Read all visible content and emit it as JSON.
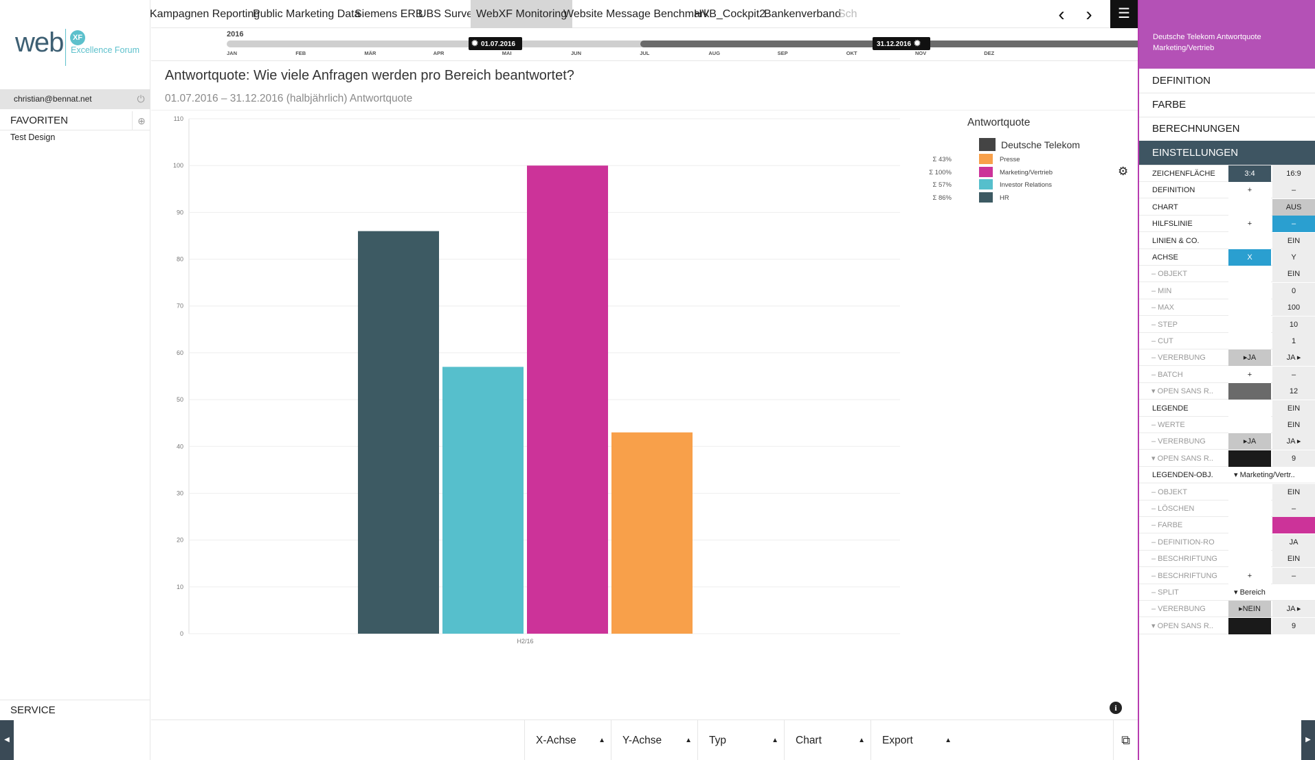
{
  "sidebar": {
    "logo_text": "web",
    "logo_badge": "XF",
    "logo_subtitle": "Excellence Forum",
    "user_email": "christian@bennat.net",
    "favorites_label": "FAVORITEN",
    "favorite_items": [
      "Test Design"
    ],
    "service_label": "SERVICE"
  },
  "tabs": [
    {
      "label": "Kampagnen Reporting",
      "active": false
    },
    {
      "label": "Public Marketing Data",
      "active": false
    },
    {
      "label": "Siemens ERB",
      "active": false
    },
    {
      "label": "UBS Survey",
      "active": false
    },
    {
      "label": "WebXF Monitoring",
      "active": true
    },
    {
      "label": "Website Message Benchmark",
      "active": false
    },
    {
      "label": "HVB_Cockpit2",
      "active": false
    },
    {
      "label": "Bankenverband",
      "active": false
    },
    {
      "label": "Sch",
      "active": false
    }
  ],
  "timeline": {
    "year": "2016",
    "start": "01.07.2016",
    "end": "31.12.2016",
    "months": [
      "JAN",
      "FEB",
      "MÄR",
      "APR",
      "MAI",
      "JUN",
      "JUL",
      "AUG",
      "SEP",
      "OKT",
      "NOV",
      "DEZ"
    ]
  },
  "title": "Antwortquote: Wie viele Anfragen werden pro Bereich beantwortet?",
  "subtitle": "01.07.2016 – 31.12.2016 (halbjährlich) Antwortquote",
  "chart_data": {
    "type": "bar",
    "categories": [
      "H2/16"
    ],
    "series": [
      {
        "name": "HR",
        "values": [
          86
        ],
        "color": "#3d5a63"
      },
      {
        "name": "Investor Relations",
        "values": [
          57
        ],
        "color": "#56bfcc"
      },
      {
        "name": "Marketing/Vertrieb",
        "values": [
          100
        ],
        "color": "#cc3399"
      },
      {
        "name": "Presse",
        "values": [
          43
        ],
        "color": "#f8a04a"
      }
    ],
    "ylim": [
      0,
      110
    ],
    "yticks": [
      0,
      10,
      20,
      30,
      40,
      50,
      60,
      70,
      80,
      90,
      100,
      110
    ],
    "grid": true,
    "legend": {
      "title": "Antwortquote",
      "placement": "top-right",
      "group": {
        "name": "Deutsche Telekom",
        "color": "#444444"
      },
      "entries": [
        {
          "pct": "Σ 43%",
          "name": "Presse",
          "color": "#f8a04a"
        },
        {
          "pct": "Σ 100%",
          "name": "Marketing/Vertrieb",
          "color": "#cc3399"
        },
        {
          "pct": "Σ 57%",
          "name": "Investor Relations",
          "color": "#56bfcc"
        },
        {
          "pct": "Σ 86%",
          "name": "HR",
          "color": "#3d5a63"
        }
      ]
    }
  },
  "bottom_toolbar": [
    "X-Achse",
    "Y-Achse",
    "Typ",
    "Chart",
    "Export"
  ],
  "panel": {
    "header_text": "Deutsche Telekom Antwortquote Marketing/Vertrieb",
    "header_color": "#b451b6",
    "sections": [
      "DEFINITION",
      "FARBE",
      "BERECHNUNGEN",
      "EINSTELLUNGEN"
    ],
    "settings": [
      {
        "label": "ZEICHENFLÄCHE",
        "c1": "3:4",
        "c2": "16:9",
        "c1cls": "c-dark",
        "c2cls": "",
        "sub": false
      },
      {
        "label": "DEFINITION",
        "c1": "+",
        "c2": "–",
        "c1cls": "",
        "c2cls": "",
        "sub": false
      },
      {
        "label": "CHART",
        "c1": "",
        "c2": "AUS",
        "c1cls": "",
        "c2cls": "c-grey",
        "sub": false
      },
      {
        "label": "HILFSLINIE",
        "c1": "+",
        "c2": "–",
        "c1cls": "",
        "c2cls": "c-blue",
        "sub": false
      },
      {
        "label": "LINIEN & CO.",
        "c1": "",
        "c2": "EIN",
        "c1cls": "",
        "c2cls": "",
        "sub": false
      },
      {
        "label": "ACHSE",
        "c1": "X",
        "c2": "Y",
        "c1cls": "c-blue",
        "c2cls": "",
        "sub": false
      },
      {
        "label": "– OBJEKT",
        "c1": "",
        "c2": "EIN",
        "c1cls": "",
        "c2cls": "",
        "sub": true
      },
      {
        "label": "– MIN",
        "c1": "",
        "c2": "0",
        "c1cls": "",
        "c2cls": "",
        "sub": true
      },
      {
        "label": "– MAX",
        "c1": "",
        "c2": "100",
        "c1cls": "",
        "c2cls": "",
        "sub": true
      },
      {
        "label": "– STEP",
        "c1": "",
        "c2": "10",
        "c1cls": "",
        "c2cls": "",
        "sub": true
      },
      {
        "label": "– CUT",
        "c1": "",
        "c2": "1",
        "c1cls": "",
        "c2cls": "",
        "sub": true
      },
      {
        "label": "– VERERBUNG",
        "c1": "▸JA",
        "c2": "JA ▸",
        "c1cls": "c-grey",
        "c2cls": "",
        "sub": true
      },
      {
        "label": "– BATCH",
        "c1": "+",
        "c2": "–",
        "c1cls": "",
        "c2cls": "",
        "sub": true
      },
      {
        "label": "▾ OPEN SANS R..",
        "c1": "",
        "c2": "12",
        "c1cls": "c-greyd",
        "c2cls": "",
        "sub": true
      },
      {
        "label": "LEGENDE",
        "c1": "",
        "c2": "EIN",
        "c1cls": "",
        "c2cls": "",
        "sub": false
      },
      {
        "label": "– WERTE",
        "c1": "",
        "c2": "EIN",
        "c1cls": "",
        "c2cls": "",
        "sub": true
      },
      {
        "label": "– VERERBUNG",
        "c1": "▸JA",
        "c2": "JA ▸",
        "c1cls": "c-grey",
        "c2cls": "",
        "sub": true
      },
      {
        "label": "▾ OPEN SANS R..",
        "c1": "",
        "c2": "9",
        "c1cls": "c-black",
        "c2cls": "",
        "sub": true
      },
      {
        "label": "LEGENDEN-OBJ.",
        "wide": "▾ Marketing/Vertr..",
        "sub": false
      },
      {
        "label": "– OBJEKT",
        "c1": "",
        "c2": "EIN",
        "c1cls": "",
        "c2cls": "",
        "sub": true
      },
      {
        "label": "– LÖSCHEN",
        "c1": "",
        "c2": "–",
        "c1cls": "",
        "c2cls": "",
        "sub": true
      },
      {
        "label": "– FARBE",
        "c1": "",
        "c2": "",
        "c1cls": "",
        "c2cls": "c-mag",
        "sub": true
      },
      {
        "label": "– DEFINITION-RO",
        "c1": "",
        "c2": "JA",
        "c1cls": "",
        "c2cls": "",
        "sub": true
      },
      {
        "label": "– BESCHRIFTUNG",
        "c1": "",
        "c2": "EIN",
        "c1cls": "",
        "c2cls": "",
        "sub": true
      },
      {
        "label": "– BESCHRIFTUNG",
        "c1": "+",
        "c2": "–",
        "c1cls": "",
        "c2cls": "",
        "sub": true
      },
      {
        "label": "– SPLIT",
        "wide": "▾ Bereich",
        "sub": true
      },
      {
        "label": "– VERERBUNG",
        "c1": "▸NEIN",
        "c2": "JA ▸",
        "c1cls": "c-grey",
        "c2cls": "",
        "sub": true
      },
      {
        "label": "▾ OPEN SANS R..",
        "c1": "",
        "c2": "9",
        "c1cls": "c-black",
        "c2cls": "",
        "sub": true
      }
    ]
  }
}
